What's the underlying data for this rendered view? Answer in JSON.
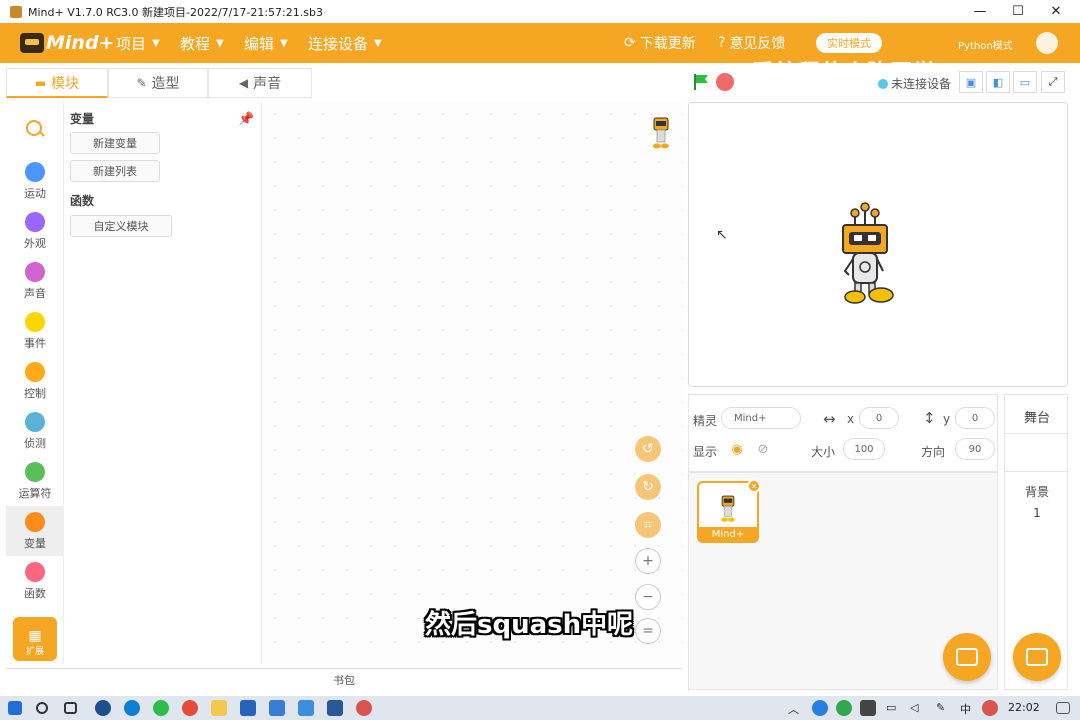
{
  "window": {
    "title": "Mind+ V1.7.0 RC3.0   新建项目-2022/7/17-21:57:21.sb3",
    "minimize": "—",
    "maximize": "☐",
    "close": "✕"
  },
  "menubar": {
    "logo": "Mind+",
    "items": [
      {
        "label": "项目"
      },
      {
        "label": "教程"
      },
      {
        "label": "编辑"
      },
      {
        "label": "连接设备"
      }
    ],
    "download_update": "下载更新",
    "feedback": "意见反馈",
    "mode_button": "实时模式",
    "python_mode": "Python模式",
    "watermark": "爱编程的小陈同学"
  },
  "tabs": [
    {
      "label": "模块",
      "icon": "blocks-icon"
    },
    {
      "label": "造型",
      "icon": "brush-icon"
    },
    {
      "label": "声音",
      "icon": "speaker-icon"
    }
  ],
  "categories": [
    {
      "label": "运动",
      "color": "#4c97ff"
    },
    {
      "label": "外观",
      "color": "#9966ff"
    },
    {
      "label": "声音",
      "color": "#cf63cf"
    },
    {
      "label": "事件",
      "color": "#ffd500"
    },
    {
      "label": "控制",
      "color": "#ffab19"
    },
    {
      "label": "侦测",
      "color": "#5cb1d6"
    },
    {
      "label": "运算符",
      "color": "#59c059"
    },
    {
      "label": "变量",
      "color": "#ff8c1a"
    },
    {
      "label": "函数",
      "color": "#ff6680"
    }
  ],
  "extension_label": "扩展",
  "palette": {
    "variables_title": "变量",
    "new_variable": "新建变量",
    "new_list": "新建列表",
    "functions_title": "函数",
    "custom_block": "自定义模块"
  },
  "subtitle": "然后squash中呢",
  "backpack": "书包",
  "stage_toolbar": {
    "connection_status": "未连接设备"
  },
  "sprite_info": {
    "sprite_label": "精灵",
    "sprite_name": "Mind+",
    "x_label": "x",
    "x_value": "0",
    "y_label": "y",
    "y_value": "0",
    "show_label": "显示",
    "size_label": "大小",
    "size_value": "100",
    "direction_label": "方向",
    "direction_value": "90"
  },
  "sprites": [
    {
      "name": "Mind+"
    }
  ],
  "stage_panel": {
    "title": "舞台",
    "backdrop_label": "背景",
    "backdrop_count": "1"
  },
  "taskbar": {
    "ime": "中",
    "time": "22:02"
  },
  "colors": {
    "accent": "#f5a623",
    "flag": "#2fbf3f",
    "stop": "#ef6a6a"
  }
}
